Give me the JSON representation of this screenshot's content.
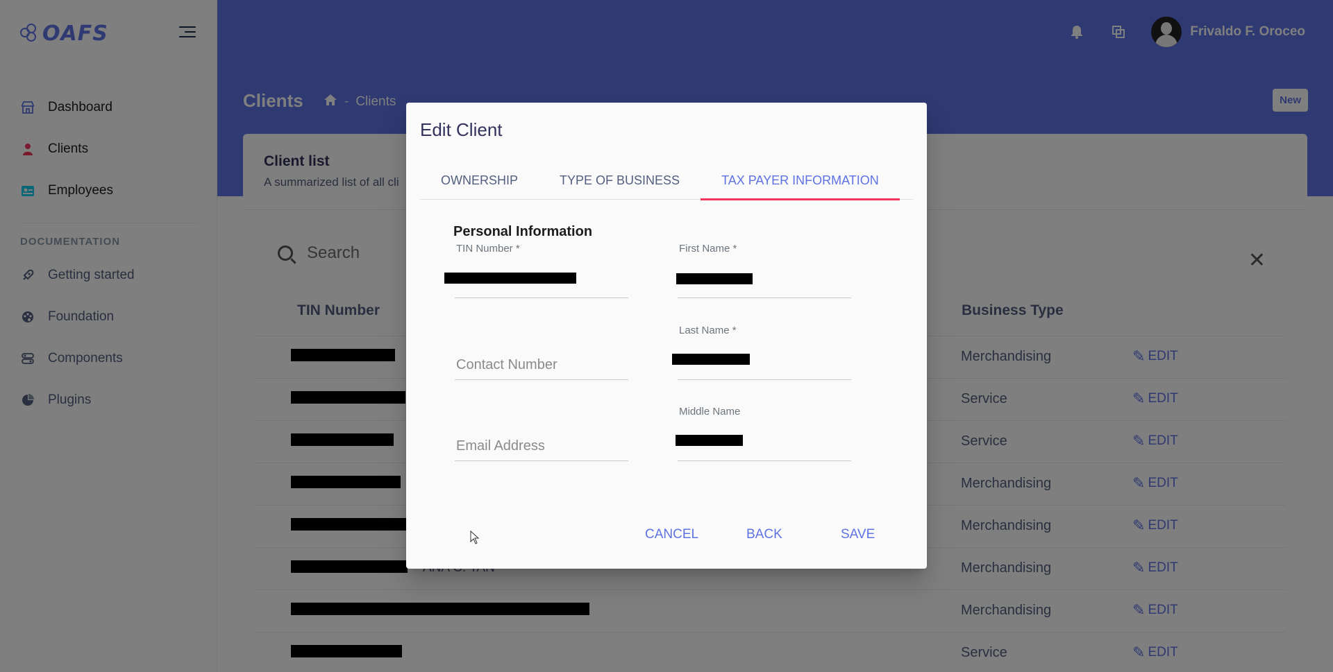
{
  "app": {
    "logo_text": "OAFS"
  },
  "sidebar": {
    "items": [
      {
        "label": "Dashboard",
        "icon": "storefront-icon",
        "color": "#5e72e4"
      },
      {
        "label": "Clients",
        "icon": "person-icon",
        "color": "#f5365c"
      },
      {
        "label": "Employees",
        "icon": "id-badge-icon",
        "color": "#11cdef"
      }
    ],
    "doc_heading": "DOCUMENTATION",
    "doc_items": [
      {
        "label": "Getting started",
        "icon": "rocket-icon"
      },
      {
        "label": "Foundation",
        "icon": "palette-icon"
      },
      {
        "label": "Components",
        "icon": "components-icon"
      },
      {
        "label": "Plugins",
        "icon": "pie-chart-icon"
      }
    ]
  },
  "header": {
    "user_name": "Frivaldo F. Oroceo",
    "page_title": "Clients",
    "breadcrumb_current": "Clients",
    "breadcrumb_sep": "-",
    "new_button": "New"
  },
  "card": {
    "title": "Client list",
    "subtitle": "A summarized list of all cli",
    "search_placeholder": "Search",
    "columns": {
      "tin": "TIN Number",
      "business_type": "Business Type"
    },
    "edit_label": "EDIT",
    "rows": [
      {
        "business_type": "Merchandising",
        "name": ""
      },
      {
        "business_type": "Service",
        "name": ""
      },
      {
        "business_type": "Service",
        "name": ""
      },
      {
        "business_type": "Merchandising",
        "name": ""
      },
      {
        "business_type": "Merchandising",
        "name": ""
      },
      {
        "business_type": "Merchandising",
        "name": "ANA C. TAN"
      },
      {
        "business_type": "Merchandising",
        "name": ""
      },
      {
        "business_type": "Service",
        "name": ""
      }
    ]
  },
  "dialog": {
    "title": "Edit Client",
    "tabs": [
      "OWNERSHIP",
      "TYPE OF BUSINESS",
      "TAX PAYER INFORMATION"
    ],
    "active_tab": "TAX PAYER INFORMATION",
    "section_title": "Personal Information",
    "fields": {
      "tin": {
        "label": "TIN Number *"
      },
      "first_name": {
        "label": "First Name *"
      },
      "contact": {
        "placeholder": "Contact Number"
      },
      "last_name": {
        "label": "Last Name *"
      },
      "email": {
        "placeholder": "Email Address"
      },
      "middle_name": {
        "label": "Middle Name"
      }
    },
    "buttons": {
      "cancel": "CANCEL",
      "back": "BACK",
      "save": "SAVE"
    }
  }
}
